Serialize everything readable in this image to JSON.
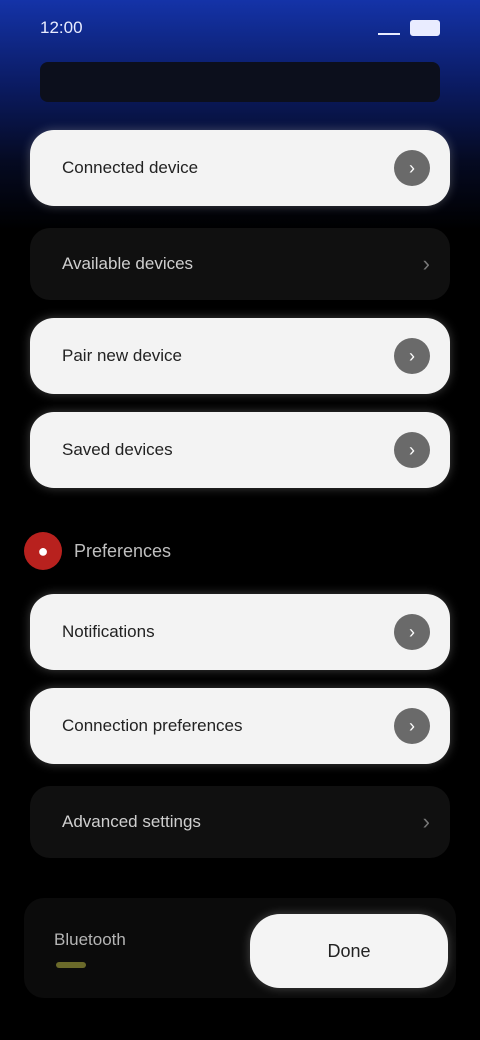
{
  "status_bar": {
    "time": "12:00"
  },
  "list_a": [
    {
      "label": "Connected device",
      "style": "white",
      "icon": "chevron-right-icon"
    },
    {
      "label": "Available devices",
      "style": "dark",
      "icon": "chevron-right-icon"
    },
    {
      "label": "Pair new device",
      "style": "white",
      "icon": "chevron-right-icon"
    },
    {
      "label": "Saved devices",
      "style": "white",
      "icon": "chevron-right-icon"
    }
  ],
  "section": {
    "title": "Preferences",
    "icon": "record-icon"
  },
  "list_b": [
    {
      "label": "Notifications",
      "style": "white",
      "icon": "chevron-right-icon"
    },
    {
      "label": "Connection preferences",
      "style": "white",
      "icon": "chevron-right-icon"
    },
    {
      "label": "Advanced settings",
      "style": "dark",
      "icon": "chevron-right-icon"
    }
  ],
  "footer": {
    "label": "Bluetooth",
    "button_label": "Done"
  },
  "colors": {
    "accent_blue": "#1433a8",
    "section_red": "#b8211e"
  }
}
